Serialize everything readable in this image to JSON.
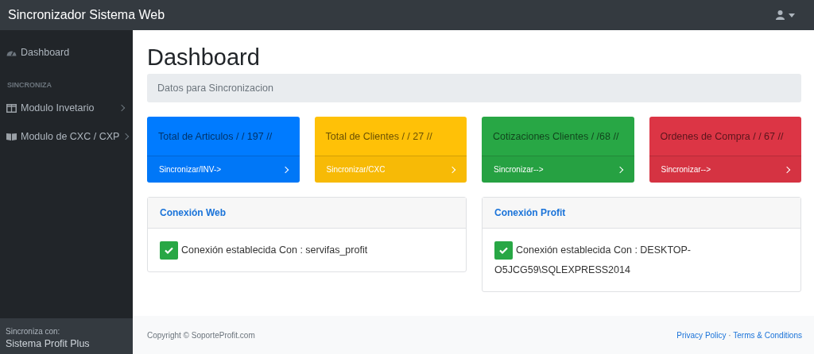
{
  "navbar": {
    "brand": "Sincronizador Sistema Web"
  },
  "sidebar": {
    "items": [
      {
        "label": "Dashboard",
        "kind": "link"
      },
      {
        "label": "SINCRONIZA",
        "kind": "heading"
      },
      {
        "label": "Modulo Invetario",
        "kind": "menu",
        "expanded": false
      },
      {
        "label": "Modulo de CXC / CXP",
        "kind": "menu",
        "expanded": false
      }
    ],
    "footer": {
      "caption": "Sincroniza con:",
      "product": "Sistema Profit Plus"
    }
  },
  "page": {
    "title": "Dashboard",
    "breadcrumb": "Datos para Sincronizacion"
  },
  "stat_cards": [
    {
      "title": "Total de Articulos / / 197 //",
      "action": "Sincronizar/INV->",
      "color": "#007bff"
    },
    {
      "title": "Total de Clientes / / 27 //",
      "action": "Sincronizar/CXC",
      "color": "#ffc107"
    },
    {
      "title": "Cotizaciones Clientes / /68 //",
      "action": "Sincronizar-->",
      "color": "#28a745"
    },
    {
      "title": "Ordenes de Compra / / 67 //",
      "action": "Sincronizar-->",
      "color": "#dc3545"
    }
  ],
  "connections": [
    {
      "title": "Conexión Web",
      "message": "Conexión establecida Con : servifas_profit",
      "connected": true
    },
    {
      "title": "Conexión Profit",
      "message": "Conexión establecida Con : DESKTOP-O5JCG59\\SQLEXPRESS2014",
      "connected": true
    }
  ],
  "footer": {
    "copyright": "Copyright © SoporteProfit.com",
    "links": [
      "Privacy Policy",
      "Terms & Conditions"
    ],
    "separator": "·"
  }
}
